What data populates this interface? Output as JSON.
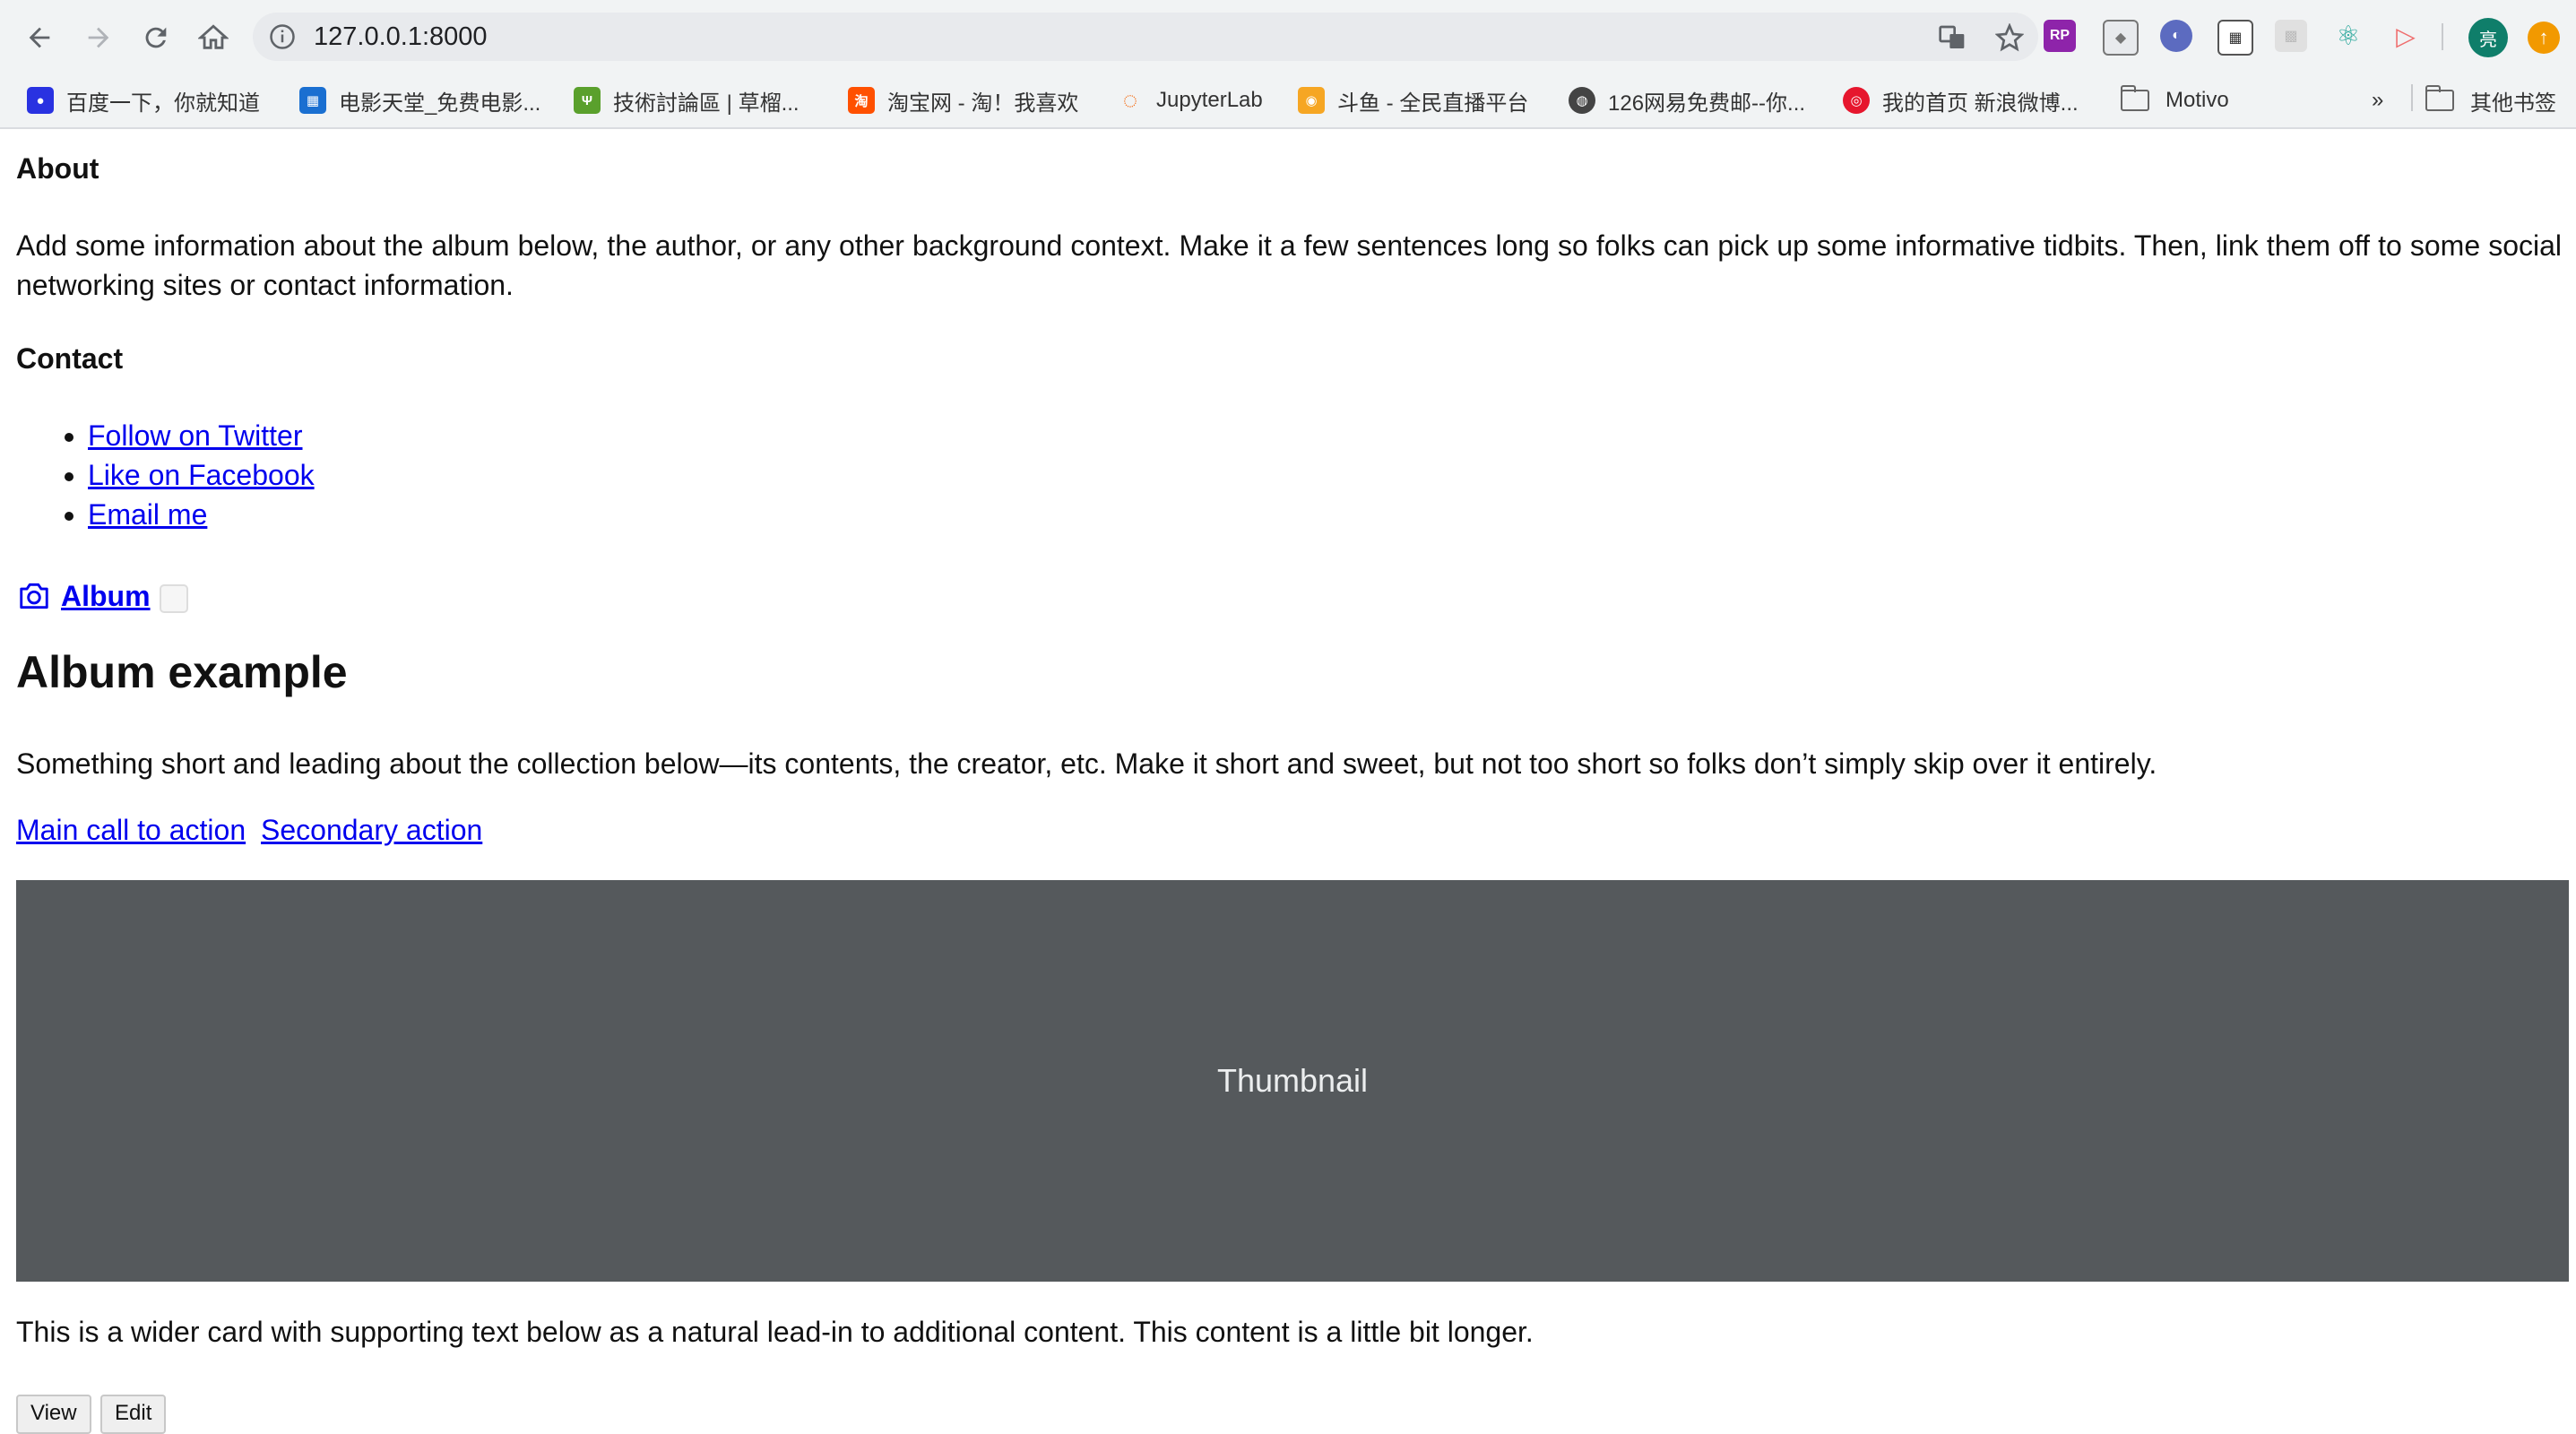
{
  "browser": {
    "url": "127.0.0.1:8000",
    "avatar_text": "亮",
    "bookmarks": [
      {
        "label": "百度一下，你就知道",
        "icon": "baidu-paw-icon",
        "color": "#2932e1"
      },
      {
        "label": "电影天堂_免费电影...",
        "icon": "movie-qr-icon",
        "color": "#1a6fd1"
      },
      {
        "label": "技術討論區 | 草榴...",
        "icon": "grass-icon",
        "color": "#5aa02c"
      },
      {
        "label": "淘宝网 - 淘！我喜欢",
        "icon": "taobao-icon",
        "color": "#ff5000"
      },
      {
        "label": "JupyterLab",
        "icon": "jupyter-icon",
        "color": "#f37726"
      },
      {
        "label": "斗鱼 - 全民直播平台",
        "icon": "douyu-icon",
        "color": "#f6a623"
      },
      {
        "label": "126网易免费邮--你...",
        "icon": "globe-icon",
        "color": "#444444"
      },
      {
        "label": "我的首页 新浪微博...",
        "icon": "weibo-icon",
        "color": "#e6162d"
      },
      {
        "label": "Motivo",
        "icon": "folder-icon"
      }
    ],
    "overflow_label": "»",
    "other_bookmarks": "其他书签"
  },
  "header": {
    "about_title": "About",
    "about_text": "Add some information about the album below, the author, or any other background context. Make it a few sentences long so folks can pick up some informative tidbits. Then, link them off to some social networking sites or contact information.",
    "contact_title": "Contact",
    "contact_links": [
      "Follow on Twitter",
      "Like on Facebook",
      "Email me"
    ],
    "brand": "Album"
  },
  "jumbotron": {
    "title": "Album example",
    "lead": "Something short and leading about the collection below—its contents, the creator, etc. Make it short and sweet, but not too short so folks don’t simply skip over it entirely.",
    "primary_action": "Main call to action",
    "secondary_action": "Secondary action"
  },
  "card": {
    "thumbnail_label": "Thumbnail",
    "text": "This is a wider card with supporting text below as a natural lead-in to additional content. This content is a little bit longer.",
    "view_button": "View",
    "edit_button": "Edit"
  }
}
